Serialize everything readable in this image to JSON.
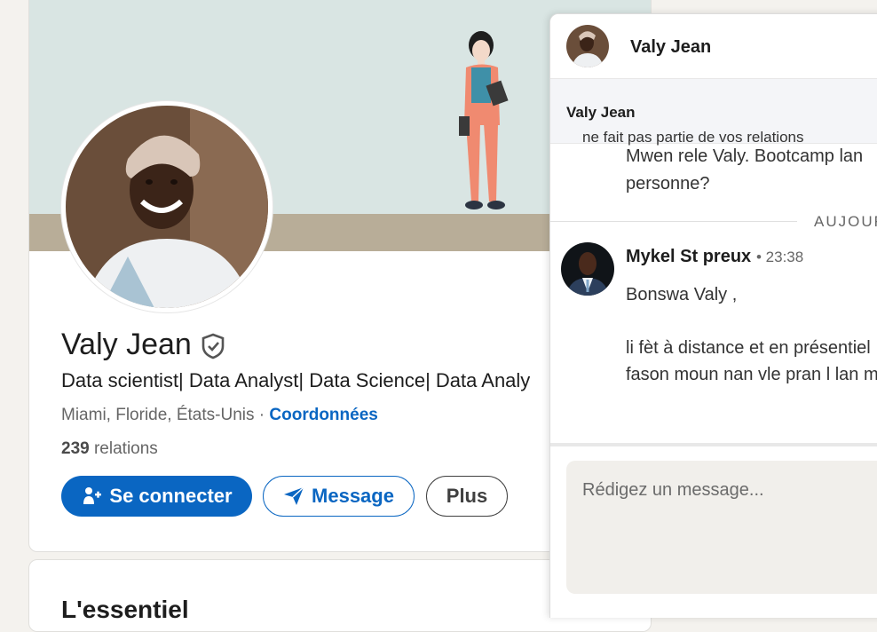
{
  "profile": {
    "name": "Valy Jean",
    "headline": "Data scientist| Data Analyst| Data Science| Data Analy",
    "location": "Miami, Floride, États-Unis",
    "location_separator": " · ",
    "contact_link": "Coordonnées",
    "relations_count": "239",
    "relations_label": " relations",
    "actions": {
      "connect_label": "Se connecter",
      "message_label": "Message",
      "more_label": "Plus"
    },
    "next_section_title": "L'essentiel"
  },
  "chat": {
    "title": "Valy Jean",
    "notice_name": "Valy Jean",
    "notice_text": " ne fait pas partie de vos relations",
    "previous_message_line1": "Mwen rele Valy. Bootcamp lan",
    "previous_message_line2": "personne?",
    "divider_label": "AUJOURD'HUI",
    "sender_name": "Mykel St preux",
    "sender_time": "• 23:38",
    "message_line1": "Bonswa Valy ,",
    "message_line2": "li fèt à distance et en présentiel",
    "message_line3": "fason moun nan vle pran l lan m",
    "composer_placeholder": "Rédigez un message..."
  },
  "colors": {
    "primary": "#0a66c2",
    "banner": "#d9e5e3",
    "page_bg": "#f4f2ee"
  },
  "icons": [
    "verified-shield-icon",
    "add-person-icon",
    "send-icon"
  ]
}
